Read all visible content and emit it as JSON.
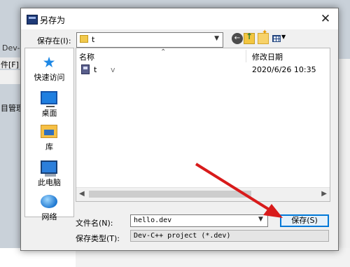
{
  "background": {
    "app_title_fragment": "Dev-C",
    "menu_fragment": "件[F]",
    "panel_fragment": "目管理"
  },
  "dialog": {
    "title": "另存为",
    "close_glyph": "✕",
    "save_in_label": "保存在(I):",
    "location": "t",
    "places": [
      {
        "label": "快速访问",
        "icon": "star-icon"
      },
      {
        "label": "桌面",
        "icon": "desktop-icon"
      },
      {
        "label": "库",
        "icon": "library-icon"
      },
      {
        "label": "此电脑",
        "icon": "computer-icon"
      },
      {
        "label": "网络",
        "icon": "network-icon"
      }
    ],
    "file_list": {
      "columns": [
        "名称",
        "修改日期"
      ],
      "rows": [
        {
          "name": "t",
          "fragment": "v",
          "modified": "2020/6/26 10:35"
        }
      ]
    },
    "filename_label": "文件名(N):",
    "filename_value": "hello.dev",
    "filetype_label": "保存类型(T):",
    "filetype_value": "Dev-C++ project (*.dev)",
    "save_button": "保存(S)"
  },
  "colors": {
    "annotation_arrow": "#d81b1b",
    "accent": "#0078d7"
  }
}
